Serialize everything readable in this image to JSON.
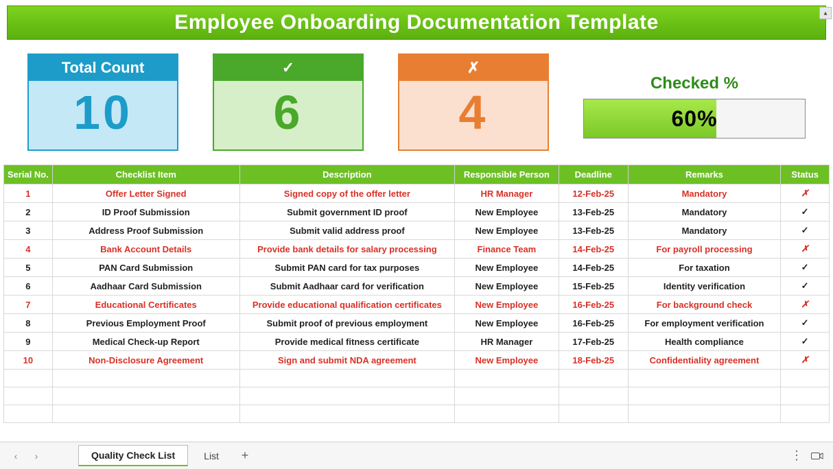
{
  "banner_title": "Employee Onboarding Documentation Template",
  "stats": {
    "total_label": "Total Count",
    "total_value": "10",
    "checked_icon": "✓",
    "checked_value": "6",
    "unchecked_icon": "✗",
    "unchecked_value": "4"
  },
  "progress": {
    "title": "Checked %",
    "value_text": "60%",
    "fill_pct": 60
  },
  "columns": {
    "serial": "Serial No.",
    "item": "Checklist Item",
    "desc": "Description",
    "resp": "Responsible Person",
    "dead": "Deadline",
    "rem": "Remarks",
    "stat": "Status"
  },
  "rows": [
    {
      "serial": "1",
      "item": "Offer Letter Signed",
      "desc": "Signed copy of the offer letter",
      "resp": "HR Manager",
      "dead": "12-Feb-25",
      "rem": "Mandatory",
      "status": "x",
      "pending": true
    },
    {
      "serial": "2",
      "item": "ID Proof Submission",
      "desc": "Submit government ID proof",
      "resp": "New Employee",
      "dead": "13-Feb-25",
      "rem": "Mandatory",
      "status": "check",
      "pending": false
    },
    {
      "serial": "3",
      "item": "Address Proof Submission",
      "desc": "Submit valid address proof",
      "resp": "New Employee",
      "dead": "13-Feb-25",
      "rem": "Mandatory",
      "status": "check",
      "pending": false
    },
    {
      "serial": "4",
      "item": "Bank Account Details",
      "desc": "Provide bank details for salary processing",
      "resp": "Finance Team",
      "dead": "14-Feb-25",
      "rem": "For payroll processing",
      "status": "x",
      "pending": true
    },
    {
      "serial": "5",
      "item": "PAN Card Submission",
      "desc": "Submit PAN card for tax purposes",
      "resp": "New Employee",
      "dead": "14-Feb-25",
      "rem": "For taxation",
      "status": "check",
      "pending": false
    },
    {
      "serial": "6",
      "item": "Aadhaar Card Submission",
      "desc": "Submit Aadhaar card for verification",
      "resp": "New Employee",
      "dead": "15-Feb-25",
      "rem": "Identity verification",
      "status": "check",
      "pending": false
    },
    {
      "serial": "7",
      "item": "Educational Certificates",
      "desc": "Provide educational qualification certificates",
      "resp": "New Employee",
      "dead": "16-Feb-25",
      "rem": "For background check",
      "status": "x",
      "pending": true
    },
    {
      "serial": "8",
      "item": "Previous Employment Proof",
      "desc": "Submit proof of previous employment",
      "resp": "New Employee",
      "dead": "16-Feb-25",
      "rem": "For employment verification",
      "status": "check",
      "pending": false
    },
    {
      "serial": "9",
      "item": "Medical Check-up Report",
      "desc": "Provide medical fitness certificate",
      "resp": "HR Manager",
      "dead": "17-Feb-25",
      "rem": "Health compliance",
      "status": "check",
      "pending": false
    },
    {
      "serial": "10",
      "item": "Non-Disclosure Agreement",
      "desc": "Sign and submit NDA agreement",
      "resp": "New Employee",
      "dead": "18-Feb-25",
      "rem": "Confidentiality agreement",
      "status": "x",
      "pending": true
    }
  ],
  "empty_row_count": 3,
  "tabs": {
    "active": "Quality Check List",
    "other": "List"
  },
  "icons": {
    "status_check": "✓",
    "status_cross": "✗",
    "add_tab": "+",
    "kebab": "⋮",
    "nav_prev": "‹",
    "nav_next": "›",
    "scroll_up": "▴"
  }
}
